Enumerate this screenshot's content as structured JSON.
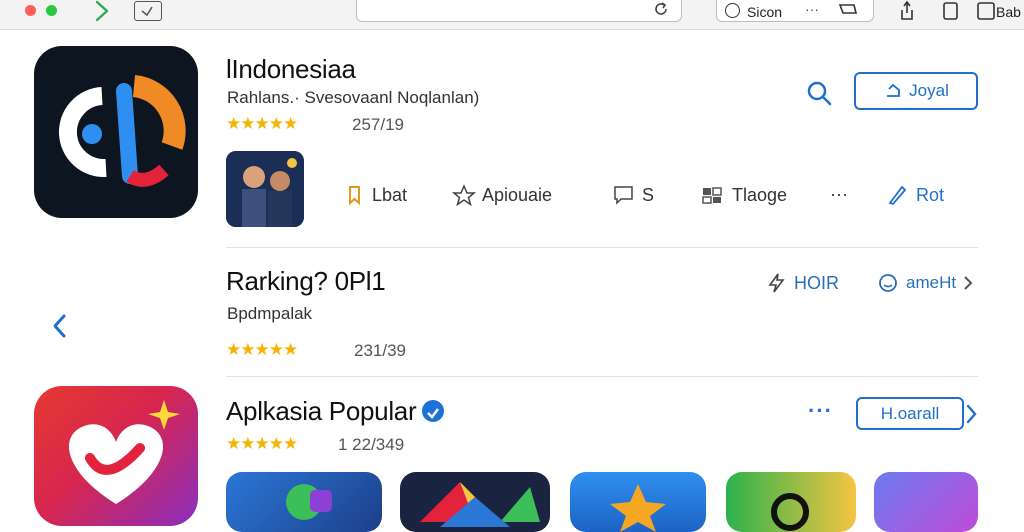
{
  "browser": {
    "site_text": "Sicon",
    "site_dots": "···",
    "right_text": "Bab"
  },
  "app": {
    "title": "lIndonesiaa",
    "subtitle": "Rahlans.· Svesovaanl Noqlanlan)",
    "stars": "★★★★★",
    "rating_count": "257/19",
    "install_label": "Joyal",
    "actions": [
      {
        "icon": "bookmark-icon",
        "label": "Lbat"
      },
      {
        "icon": "star-icon",
        "label": "Apiouaie"
      },
      {
        "icon": "message-icon",
        "label": "S"
      },
      {
        "icon": "grid-icon",
        "label": "Tlaoge"
      },
      {
        "icon": "more-icon",
        "label": "···"
      },
      {
        "icon": "edit-icon",
        "label": "Rot"
      }
    ]
  },
  "ranking": {
    "title": "Rarking? 0Pl1",
    "subtitle": "Bpdmpalak",
    "stars": "★★★★★",
    "rating_count": "231/39",
    "hoir_label": "HOIR",
    "ameht_label": "ameHt"
  },
  "popular": {
    "title": "Aplkasia Popular",
    "stars": "★★★★★",
    "rating_count": "1 22/349",
    "more_dots": "···",
    "hoarall_label": "H.oarall"
  },
  "colors": {
    "accent": "#1f6fcc",
    "star": "#f4b400"
  }
}
